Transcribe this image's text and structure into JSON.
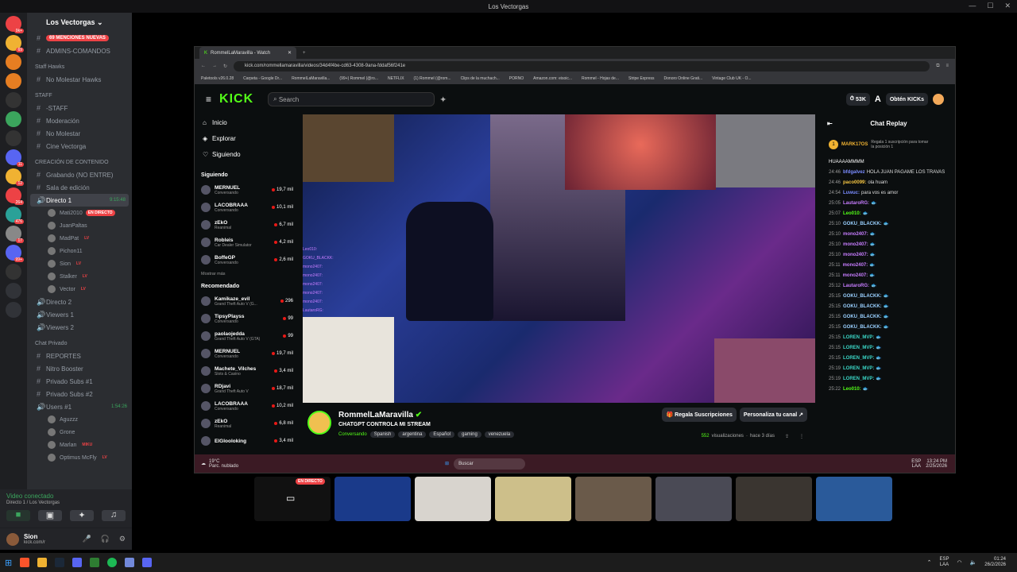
{
  "window": {
    "title": "Los Vectorgas"
  },
  "rail": {
    "servers": [
      {
        "color": "#ed4245",
        "badge": "9k+"
      },
      {
        "color": "#f0b232",
        "badge": "69"
      },
      {
        "color": "#e67e22",
        "badge": ""
      },
      {
        "color": "#e67e22",
        "badge": ""
      },
      {
        "color": "#333333",
        "badge": ""
      },
      {
        "color": "#3ba55d",
        "badge": ""
      },
      {
        "color": "#333333",
        "badge": ""
      },
      {
        "color": "#5865f2",
        "badge": "11"
      },
      {
        "color": "#f0b232",
        "badge": "12"
      },
      {
        "color": "#ed4245",
        "badge": "264"
      },
      {
        "color": "#2aa198",
        "badge": "476"
      },
      {
        "color": "#888888",
        "badge": "17"
      },
      {
        "color": "#5865f2",
        "badge": "99+"
      },
      {
        "color": "#333333",
        "badge": ""
      }
    ]
  },
  "sidebar": {
    "server_name": "Los Vectorgas",
    "mentions_badge": "69 MENCIONES NUEVAS",
    "top_channels": [
      "ADMINS-COMANDOS"
    ],
    "categories": [
      {
        "name": "Staff Hawks",
        "channels": [
          "No Molestar Hawks"
        ]
      },
      {
        "name": "STAFF",
        "channels": [
          "-STAFF",
          "Moderación",
          "No Molestar",
          "Cine Vectorga"
        ]
      },
      {
        "name": "CREACIÓN DE CONTENIDO",
        "channels": [
          "Grabando (NO ENTRE)",
          "Sala de edición"
        ]
      }
    ],
    "active_channel": {
      "name": "Directo 1",
      "time": "9:15:48"
    },
    "voice_users": [
      {
        "name": "Mati2010",
        "badge": "EN DIRECTO"
      },
      {
        "name": "JuanPaltas",
        "badge": ""
      },
      {
        "name": "MadPat",
        "badge": "LV"
      },
      {
        "name": "Pichon11",
        "badge": ""
      },
      {
        "name": "Sion",
        "badge": "LV"
      },
      {
        "name": "Stalker",
        "badge": "LV"
      },
      {
        "name": "Vector",
        "badge": "LV"
      }
    ],
    "more_channels": [
      "Directo 2",
      "Viewers 1",
      "Viewers 2"
    ],
    "private_category": "Chat Privado",
    "private_channels": [
      "REPORTES",
      "Nitro Booster",
      "Privado Subs #1",
      "Privado Subs #2"
    ],
    "users_channel": {
      "name": "Users #1",
      "time": "1:54:26"
    },
    "users_list": [
      {
        "name": "Aguzzz",
        "badge": ""
      },
      {
        "name": "Grone",
        "badge": ""
      },
      {
        "name": "Marlan",
        "badge": "MIKU"
      },
      {
        "name": "Optimus McFly",
        "badge": "LV"
      }
    ]
  },
  "voice_panel": {
    "status": "Video conectado",
    "channel": "Directo 1 / Los Vectorgas"
  },
  "user_panel": {
    "name": "Sion",
    "status": "kick.com/r"
  },
  "browser": {
    "tab_title": "RommelLaMaravilla - Watch",
    "url": "kick.com/rommellamaravilla/videos/34d4f4be-cd63-4308-9ana-fddaf56f241e",
    "bookmarks": [
      "Paletools v26.0.28",
      "Carpeta - Google Dr...",
      "RommelLaMaravilla...",
      "(99+) Rommel (@ro...",
      "NETFLIX",
      "(1) Rommel (@rom...",
      "Clips de la muchach...",
      "PORNO",
      "Amazon.com: eisoic...",
      "Rommel - Hojas de...",
      "Stripe Express",
      "Donoro Online Grati...",
      "Vintage Club UK - O..."
    ]
  },
  "kick": {
    "search_placeholder": "Search",
    "viewers_chip": "53K",
    "get_kicks": "Obtén KICKs",
    "nav": [
      "Inicio",
      "Explorar",
      "Siguiendo"
    ],
    "following_title": "Siguiendo",
    "following": [
      {
        "name": "MERNUEL",
        "sub": "Conversando",
        "viewers": "19,7 mil"
      },
      {
        "name": "LACOBRAAA",
        "sub": "Conversando",
        "viewers": "10,1 mil"
      },
      {
        "name": "zEkO",
        "sub": "Reanimal",
        "viewers": "6,7 mil"
      },
      {
        "name": "Robleis",
        "sub": "Car Dealer Simulator",
        "viewers": "4,2 mil"
      },
      {
        "name": "BoffeGP",
        "sub": "Conversando",
        "viewers": "2,6 mil"
      }
    ],
    "show_more": "Mostrar más",
    "recommended_title": "Recomendado",
    "recommended": [
      {
        "name": "Kamikaze_evil",
        "sub": "Grand Theft Auto V (G...",
        "viewers": "296"
      },
      {
        "name": "TipsyPlayss",
        "sub": "Conversando",
        "viewers": "99"
      },
      {
        "name": "paolaojedda",
        "sub": "Grand Theft Auto V (GTA)",
        "viewers": "99"
      },
      {
        "name": "MERNUEL",
        "sub": "Conversando",
        "viewers": "19,7 mil"
      },
      {
        "name": "Machete_Vilches",
        "sub": "Slots & Casino",
        "viewers": "3,4 mil"
      },
      {
        "name": "RDjavi",
        "sub": "Grand Theft Auto V",
        "viewers": "18,7 mil"
      },
      {
        "name": "LACOBRAAA",
        "sub": "Conversando",
        "viewers": "10,2 mil"
      },
      {
        "name": "zEkO",
        "sub": "Reanimal",
        "viewers": "6,8 mil"
      },
      {
        "name": "ElGlooloking",
        "sub": "",
        "viewers": "3,4 mil"
      }
    ],
    "stream": {
      "channel": "RommelLaMaravilla",
      "title": "CHATGPT CONTROLA MI STREAM",
      "category": "Conversando",
      "tags": [
        "Spanish",
        "argentina",
        "Español",
        "gaming",
        "venezuela"
      ],
      "views": "552",
      "views_label": "visualizaciones",
      "ago": "hace 3 días",
      "gift_button": "Regala Suscripciones",
      "customize_button": "Personaliza tu canal"
    },
    "chat": {
      "title": "Chat Replay",
      "pinned_user": "MARK17OS",
      "pinned_text": "Regala 1 suscripción para tomar la posición 1",
      "first_line": "HUAAAAMMMM",
      "messages": [
        {
          "time": "24:46",
          "user": "bfdgalvez",
          "text": "HOLA JUAN PAGAME LOS TRAVAS",
          "color": "#7a8cff"
        },
        {
          "time": "24:46",
          "user": "paco0099:",
          "text": "ola huam",
          "color": "#f5c542"
        },
        {
          "time": "24:54",
          "user": "Luwuc:",
          "text": "para vos es amor",
          "color": "#7a8cff"
        },
        {
          "time": "25:05",
          "user": "LautaroRG:",
          "text": "",
          "color": "#c77dff"
        },
        {
          "time": "25:07",
          "user": "Leo010:",
          "text": "",
          "color": "#53fc18"
        },
        {
          "time": "25:10",
          "user": "GOKU_BLACKK:",
          "text": "",
          "color": "#9ad0ff"
        },
        {
          "time": "25:10",
          "user": "mono2407:",
          "text": "",
          "color": "#c77dff"
        },
        {
          "time": "25:10",
          "user": "mono2407:",
          "text": "",
          "color": "#c77dff"
        },
        {
          "time": "25:10",
          "user": "mono2407:",
          "text": "",
          "color": "#c77dff"
        },
        {
          "time": "25:11",
          "user": "mono2407:",
          "text": "",
          "color": "#c77dff"
        },
        {
          "time": "25:11",
          "user": "mono2407:",
          "text": "",
          "color": "#c77dff"
        },
        {
          "time": "25:12",
          "user": "LautaroRG:",
          "text": "",
          "color": "#c77dff"
        },
        {
          "time": "25:15",
          "user": "GOKU_BLACKK:",
          "text": "",
          "color": "#9ad0ff"
        },
        {
          "time": "25:15",
          "user": "GOKU_BLACKK:",
          "text": "",
          "color": "#9ad0ff"
        },
        {
          "time": "25:15",
          "user": "GOKU_BLACKK:",
          "text": "",
          "color": "#9ad0ff"
        },
        {
          "time": "25:15",
          "user": "GOKU_BLACKK:",
          "text": "",
          "color": "#9ad0ff"
        },
        {
          "time": "25:15",
          "user": "LOREN_MVP:",
          "text": "",
          "color": "#3ad6c6"
        },
        {
          "time": "25:15",
          "user": "LOREN_MVP:",
          "text": "",
          "color": "#3ad6c6"
        },
        {
          "time": "25:15",
          "user": "LOREN_MVP:",
          "text": "",
          "color": "#3ad6c6"
        },
        {
          "time": "25:19",
          "user": "LOREN_MVP:",
          "text": "",
          "color": "#3ad6c6"
        },
        {
          "time": "25:19",
          "user": "LOREN_MVP:",
          "text": "",
          "color": "#3ad6c6"
        },
        {
          "time": "25:22",
          "user": "Leo010:",
          "text": "",
          "color": "#53fc18"
        }
      ]
    },
    "video_overlay": {
      "chat_lines": [
        "Leo010:",
        "GOKU_BLACKK:",
        "mono2407:",
        "mono2407:",
        "mono2407:",
        "mono2407:",
        "mono2407:",
        "LautaroRG:"
      ]
    }
  },
  "inner_taskbar": {
    "weather_temp": "19°C",
    "weather_text": "Parc. nublado",
    "search": "Buscar",
    "lang": "ESP",
    "region": "LAA",
    "time": "13:24 PM",
    "date": "2/25/2026"
  },
  "strip": {
    "live_badge": "EN DIRECTO"
  },
  "taskbar": {
    "lang": "ESP",
    "region": "LAA",
    "time": "01:24",
    "date": "26/2/2026"
  }
}
